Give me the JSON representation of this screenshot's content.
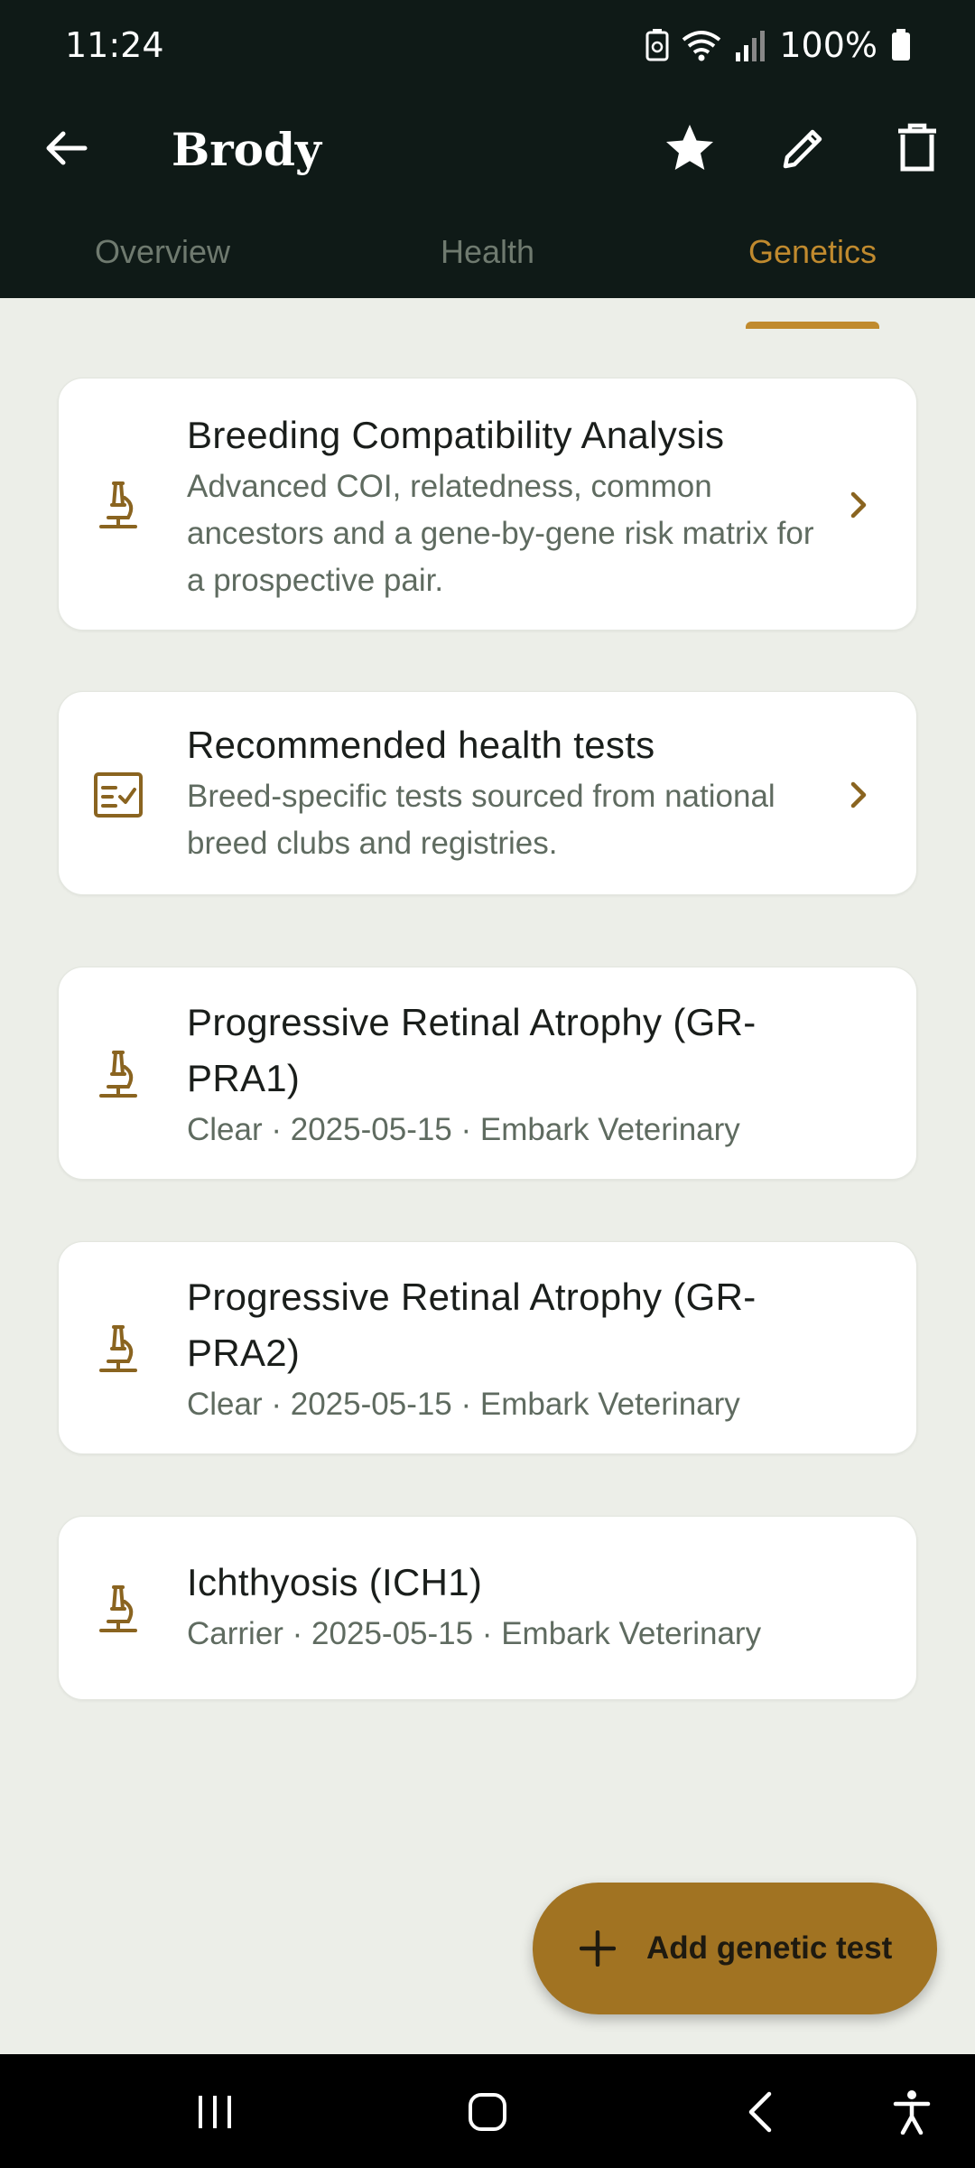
{
  "status": {
    "time": "11:24",
    "battery": "100%"
  },
  "app_bar": {
    "title": "Brody"
  },
  "tabs": [
    {
      "label": "Overview",
      "active": false
    },
    {
      "label": "Health",
      "active": false
    },
    {
      "label": "Genetics",
      "active": true
    }
  ],
  "cards": [
    {
      "icon": "microscope-icon",
      "title": "Breeding Compatibility Analysis",
      "subtitle": "Advanced COI, relatedness, common ancestors and a gene-by-gene risk matrix for a prospective pair.",
      "chevron": true
    },
    {
      "icon": "checklist-icon",
      "title": "Recommended health tests",
      "subtitle": "Breed-specific tests sourced from national breed clubs and registries.",
      "chevron": true
    },
    {
      "icon": "microscope-icon",
      "title": "Progressive Retinal Atrophy (GR-PRA1)",
      "subtitle": "Clear · 2025-05-15 · Embark Veterinary",
      "chevron": false
    },
    {
      "icon": "microscope-icon",
      "title": "Progressive Retinal Atrophy (GR-PRA2)",
      "subtitle": "Clear · 2025-05-15 · Embark Veterinary",
      "chevron": false
    },
    {
      "icon": "microscope-icon",
      "title": "Ichthyosis (ICH1)",
      "subtitle": "Carrier · 2025-05-15 · Embark Veterinary",
      "chevron": false
    }
  ],
  "fab": {
    "label": "Add genetic test"
  },
  "colors": {
    "accent": "#c08a2e",
    "fab": "#a17322",
    "header": "#0f1a17",
    "background": "#eceee8"
  }
}
